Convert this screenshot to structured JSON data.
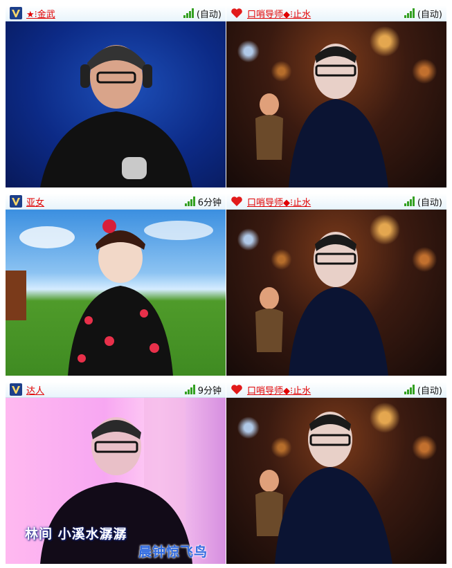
{
  "rows": [
    {
      "left": {
        "name": "★⁝金武",
        "status": "(自动)"
      },
      "right": {
        "name": "口哨导师◆⁝止水",
        "status": "(自动)"
      }
    },
    {
      "left": {
        "name": "亚女",
        "status": "6分钟"
      },
      "right": {
        "name": "口哨导师◆⁝止水",
        "status": "(自动)"
      }
    },
    {
      "left": {
        "name": "达人",
        "status": "9分钟"
      },
      "right": {
        "name": "口哨导师◆⁝止水",
        "status": "(自动)"
      }
    }
  ],
  "lyrics": {
    "line1": "林间  小溪水潺潺",
    "line2": "晨钟惊飞鸟"
  },
  "colors": {
    "username": "#e10000",
    "signal": "#33a021",
    "header_bg": "#e9f4fb"
  },
  "icons": {
    "rank": "rank-badge-icon",
    "heart": "heart-icon",
    "signal": "signal-strength-icon"
  }
}
